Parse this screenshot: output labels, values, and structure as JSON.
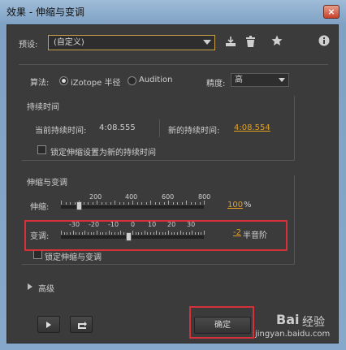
{
  "window": {
    "title": "效果 - 伸缩与变调",
    "close_label": "×"
  },
  "preset": {
    "label": "预设:",
    "value": "(自定义)"
  },
  "algorithm": {
    "label": "算法:",
    "options": [
      "iZotope 半径",
      "Audition"
    ],
    "selected": "iZotope 半径",
    "precision_label": "精度:",
    "precision_value": "高"
  },
  "duration": {
    "group_label": "持续时间",
    "current_label": "当前持续时间:",
    "current_value": "4:08.555",
    "new_label": "新的持续时间:",
    "new_value": "4:08.554",
    "lock_label": "锁定伸缩设置为新的持续时间"
  },
  "stretch_pitch": {
    "group_label": "伸缩与变调",
    "stretch_label": "伸缩:",
    "stretch_ticks": [
      "200",
      "400",
      "600",
      "800"
    ],
    "stretch_value": "100",
    "stretch_unit": "%",
    "stretch_level": 100,
    "pitch_label": "变调:",
    "pitch_ticks": [
      "-30",
      "-20",
      "-10",
      "0",
      "10",
      "20",
      "30"
    ],
    "pitch_value": "-2",
    "pitch_unit": "半音阶",
    "pitch_level": -2,
    "lock_label": "锁定伸缩与变调"
  },
  "advanced": {
    "label": "高级"
  },
  "footer": {
    "ok_label": "确定"
  },
  "watermark": {
    "line1": "Bai",
    "line2": "经验",
    "line3": "jingyan.baidu.com"
  }
}
